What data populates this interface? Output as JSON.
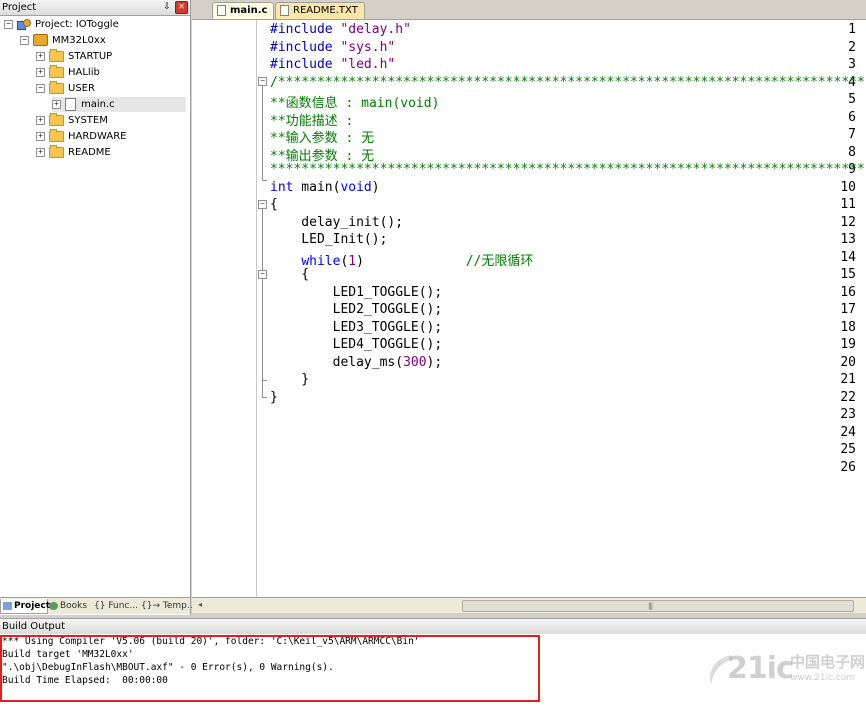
{
  "project_panel": {
    "title": "Project",
    "pin_glyph": "⇩",
    "close_glyph": "×",
    "tree": [
      {
        "label": "Project: IOToggle",
        "type": "project",
        "expander": "−"
      },
      {
        "label": "MM32L0xx",
        "type": "target",
        "expander": "−"
      },
      {
        "label": "STARTUP",
        "type": "folder",
        "expander": "+"
      },
      {
        "label": "HALlib",
        "type": "folder",
        "expander": "+"
      },
      {
        "label": "USER",
        "type": "folder",
        "expander": "−"
      },
      {
        "label": "main.c",
        "type": "file",
        "expander": "+"
      },
      {
        "label": "SYSTEM",
        "type": "folder",
        "expander": "+"
      },
      {
        "label": "HARDWARE",
        "type": "folder",
        "expander": "+"
      },
      {
        "label": "README",
        "type": "folder",
        "expander": "+"
      }
    ],
    "tabs": [
      {
        "label": "Project",
        "icon": "project-tab-icon",
        "active": true
      },
      {
        "label": "Books",
        "icon": "books-tab-icon",
        "active": false
      },
      {
        "label": "{} Func...",
        "icon": "functions-tab-icon",
        "active": false
      },
      {
        "label": "{}→ Temp...",
        "icon": "templates-tab-icon",
        "active": false
      }
    ]
  },
  "editor": {
    "tabs": [
      {
        "label": "main.c",
        "active": true
      },
      {
        "label": "README.TXT",
        "active": false
      }
    ],
    "line_numbers": [
      "1",
      "2",
      "3",
      "4",
      "5",
      "6",
      "7",
      "8",
      "9",
      "10",
      "11",
      "12",
      "13",
      "14",
      "15",
      "16",
      "17",
      "18",
      "19",
      "20",
      "21",
      "22",
      "23",
      "24",
      "25",
      "26"
    ],
    "code": {
      "l1_pp": "#include ",
      "l1_str": "\"delay.h\"",
      "l2_pp": "#include ",
      "l2_str": "\"sys.h\"",
      "l3_pp": "#include ",
      "l3_str": "\"led.h\"",
      "l4": "/*******************************************************************************",
      "l5": "**函数信息 : main(void)",
      "l6": "**功能描述 :",
      "l7": "**输入参数 : 无",
      "l8": "**输出参数 : 无",
      "l9": "*******************************************************************************/",
      "l10_kw": "int",
      "l10_rest": " main(",
      "l10_kw2": "void",
      "l10_end": ")",
      "l11": "{",
      "l12": "    delay_init();",
      "l13": "    LED_Init();",
      "l14_indent": "    ",
      "l14_kw": "while",
      "l14_open": "(",
      "l14_num": "1",
      "l14_close": ")",
      "l14_pad": "             ",
      "l14_com": "//无限循环",
      "l15": "    {",
      "l16": "        LED1_TOGGLE();",
      "l17": "        LED2_TOGGLE();",
      "l18": "        LED3_TOGGLE();",
      "l19": "        LED4_TOGGLE();",
      "l20_a": "        delay_ms(",
      "l20_num": "300",
      "l20_b": ");",
      "l21": "    }",
      "l22": "}"
    },
    "fold_markers": [
      "−",
      "−",
      "−"
    ],
    "scroll_left_glyph": "◂",
    "scroll_grip": "|||"
  },
  "build_output": {
    "title": "Build Output",
    "lines": [
      "*** Using Compiler 'V5.06 (build 20)', folder: 'C:\\Keil_v5\\ARM\\ARMCC\\Bin'",
      "Build target 'MM32L0xx'",
      "\".\\obj\\DebugInFlash\\MBOUT.axf\" - 0 Error(s), 0 Warning(s).",
      "Build Time Elapsed:  00:00:00"
    ]
  },
  "watermark": {
    "brand": "21ic",
    "cn": "中国电子网",
    "url": "www.21ic.com"
  },
  "colors": {
    "preprocessor": "#0000c8",
    "string": "#800080",
    "comment": "#008000",
    "keyword": "#0000ff",
    "number": "#800080",
    "highlight_box": "#e02020"
  }
}
